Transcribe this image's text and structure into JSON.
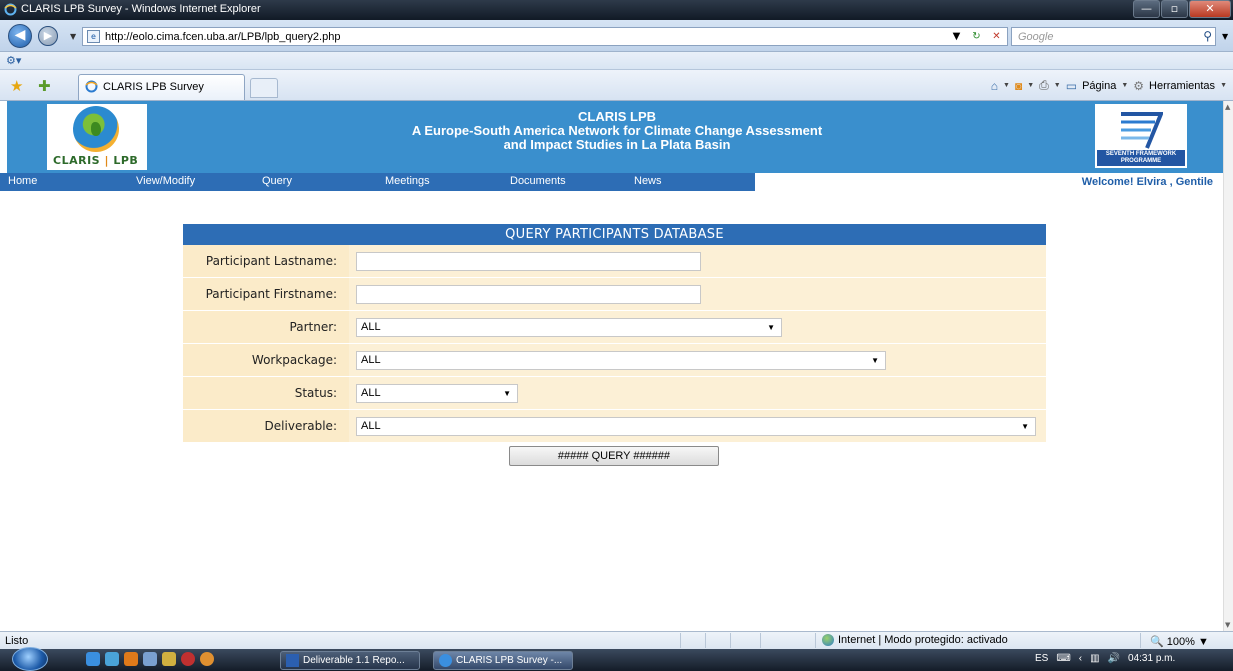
{
  "window": {
    "title": "CLARIS LPB Survey - Windows Internet Explorer",
    "controls": {
      "minimize": "—",
      "maximize": "▫",
      "close": "✕"
    }
  },
  "addressbar": {
    "url": "http://eolo.cima.fcen.uba.ar/LPB/lpb_query2.php",
    "search_placeholder": "Google"
  },
  "tab": {
    "label": "CLARIS LPB Survey"
  },
  "toolbar": {
    "page_label": "Página",
    "tools_label": "Herramientas"
  },
  "site": {
    "logo_left_text_a": "CLARIS",
    "logo_left_sep": "|",
    "logo_left_text_b": "LPB",
    "title_line1": "CLARIS LPB",
    "title_line2": "A Europe-South America Network for Climate Change Assessment",
    "title_line3": "and Impact Studies in La Plata Basin",
    "logo_right_text": "SEVENTH FRAMEWORK PROGRAMME"
  },
  "nav": {
    "items": [
      "Home",
      "View/Modify",
      "Query",
      "Meetings",
      "Documents",
      "News"
    ],
    "welcome": "Welcome! Elvira , Gentile"
  },
  "form": {
    "heading": "QUERY PARTICIPANTS DATABASE",
    "lastname_label": "Participant Lastname:",
    "lastname_value": "",
    "firstname_label": "Participant Firstname:",
    "firstname_value": "",
    "partner_label": "Partner:",
    "partner_value": "ALL",
    "workpackage_label": "Workpackage:",
    "workpackage_value": "ALL",
    "status_label": "Status:",
    "status_value": "ALL",
    "deliverable_label": "Deliverable:",
    "deliverable_value": "ALL",
    "query_button": "#####    QUERY  ######"
  },
  "statusbar": {
    "status": "Listo",
    "zone": "Internet | Modo protegido: activado",
    "zoom": "100%"
  },
  "taskbar": {
    "tasks": [
      "Deliverable 1.1 Repo...",
      "CLARIS LPB Survey -..."
    ],
    "lang": "ES",
    "clock": "04:31 p.m."
  }
}
